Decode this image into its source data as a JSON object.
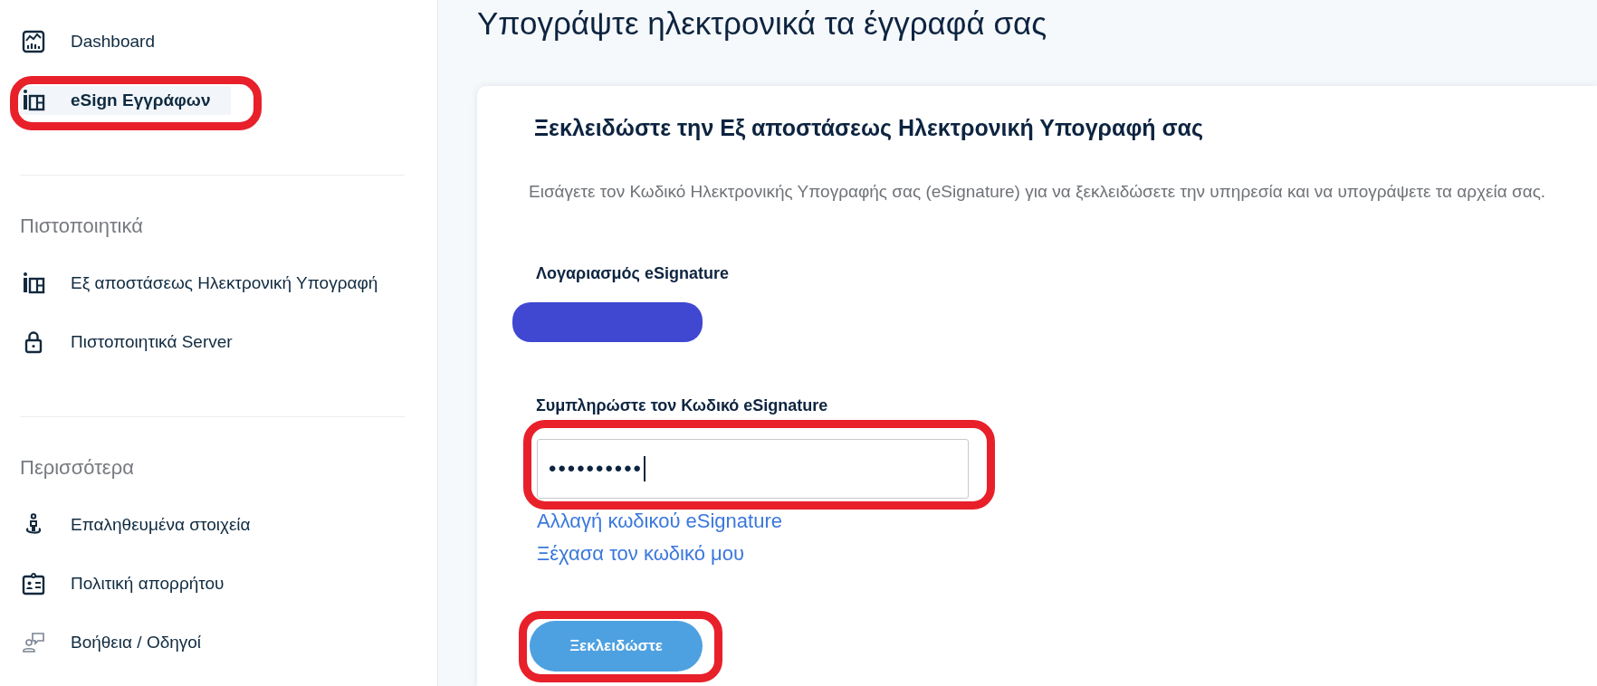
{
  "sidebar": {
    "sections": [
      {
        "items": [
          {
            "label": "Dashboard",
            "selected": false,
            "annotated": false
          },
          {
            "label": "eSign Εγγράφων",
            "selected": true,
            "annotated": true
          }
        ]
      },
      {
        "title": "Πιστοποιητικά",
        "items": [
          {
            "label": "Εξ αποστάσεως Ηλεκτρονική Υπογραφή",
            "selected": false,
            "annotated": false
          },
          {
            "label": "Πιστοποιητικά Server",
            "selected": false,
            "annotated": false
          }
        ]
      },
      {
        "title": "Περισσότερα",
        "items": [
          {
            "label": "Επαληθευμένα στοιχεία",
            "selected": false,
            "annotated": false
          },
          {
            "label": "Πολιτική απορρήτου",
            "selected": false,
            "annotated": false
          },
          {
            "label": "Βοήθεια / Οδηγοί",
            "selected": false,
            "annotated": false
          }
        ]
      }
    ]
  },
  "page_title": "Υπογράψτε ηλεκτρονικά τα έγγραφά σας",
  "card": {
    "heading": "Ξεκλειδώστε την Εξ αποστάσεως Ηλεκτρονική Υπογραφή σας",
    "description": "Εισάγετε τον Κωδικό Ηλεκτρονικής Υπογραφής σας (eSignature) για να ξεκλειδώσετε την υπηρεσία και να υπογράψετε τα αρχεία σας.",
    "account": {
      "label": "Λογαριασμός eSignature",
      "redacted": true
    },
    "password": {
      "label": "Συμπληρώστε τον Κωδικό eSignature",
      "value": "••••••••••",
      "focused": true,
      "annotated": true
    },
    "links": [
      "Αλλαγή κωδικού eSignature",
      "Ξέχασα τον κωδικό μου"
    ],
    "button": {
      "label": "Ξεκλειδώστε",
      "annotated": true
    }
  }
}
